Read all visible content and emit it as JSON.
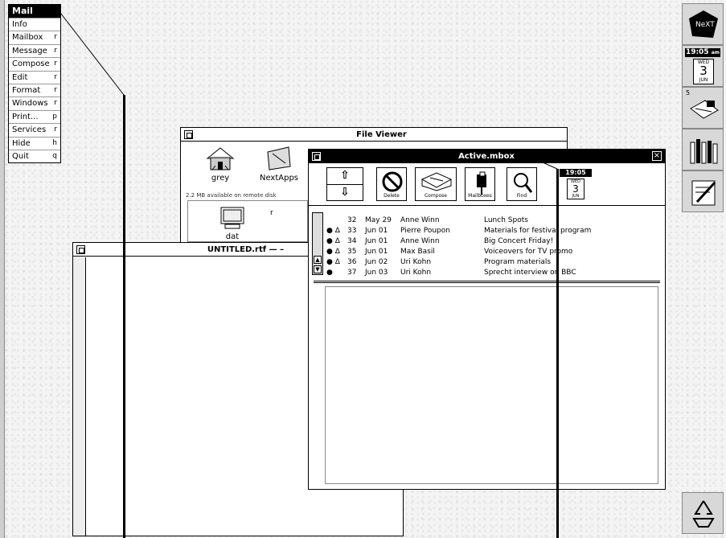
{
  "menu": {
    "title": "Mail",
    "items": [
      {
        "label": "Info",
        "key": ""
      },
      {
        "label": "Mailbox",
        "key": "r"
      },
      {
        "label": "Message",
        "key": "r"
      },
      {
        "label": "Compose",
        "key": "r"
      },
      {
        "label": "Edit",
        "key": "r"
      },
      {
        "label": "Format",
        "key": "r"
      },
      {
        "label": "Windows",
        "key": "r"
      },
      {
        "label": "Print...",
        "key": "p"
      },
      {
        "label": "Services",
        "key": "r"
      },
      {
        "label": "Hide",
        "key": "h"
      },
      {
        "label": "Quit",
        "key": "q"
      }
    ]
  },
  "file_viewer": {
    "title": "File Viewer",
    "icons": [
      "grey",
      "NextApps"
    ],
    "free_space": "2.2 MB available on remote disk",
    "file_label": "dat"
  },
  "untitled": {
    "title": "UNTITLED.rtf — –"
  },
  "mail": {
    "title": "Active.mbox",
    "buttons": [
      "Delete",
      "Compose",
      "Mailboxes",
      "Find"
    ],
    "messages": [
      {
        "num": "32",
        "date": "May 29",
        "from": "Anne Winn",
        "subject": "Lunch Spots",
        "flag": ""
      },
      {
        "num": "33",
        "date": "Jun 01",
        "from": "Pierre Poupon",
        "subject": "Materials for festival program",
        "flag": "● Δ"
      },
      {
        "num": "34",
        "date": "Jun 01",
        "from": "Anne Winn",
        "subject": "Big Concert Friday!",
        "flag": "● Δ"
      },
      {
        "num": "35",
        "date": "Jun 01",
        "from": "Max Basil",
        "subject": "Voiceovers for TV promo",
        "flag": "● Δ"
      },
      {
        "num": "36",
        "date": "Jun 02",
        "from": "Uri Kohn",
        "subject": "Program materials",
        "flag": "● Δ"
      },
      {
        "num": "37",
        "date": "Jun 03",
        "from": "Uri Kohn",
        "subject": "Sprecht interview on BBC",
        "flag": "●"
      }
    ]
  },
  "dock": {
    "clock_time": "19:05",
    "clock_am": "am",
    "day": "WED",
    "date": "3",
    "month": "JUN",
    "mail_count": "5"
  }
}
